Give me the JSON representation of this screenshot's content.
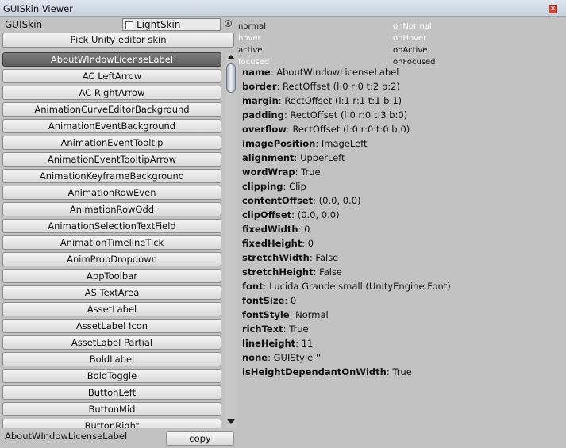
{
  "window": {
    "title": "GUISkin Viewer"
  },
  "skin_field": {
    "label": "GUISkin",
    "value": "LightSkin"
  },
  "pick_button": "Pick Unity editor skin",
  "states": {
    "normal": "normal",
    "onNormal": "onNormal",
    "hover": "hover",
    "onHover": "onHover",
    "active": "active",
    "onActive": "onActive",
    "focused": "focused",
    "onFocused": "onFocused"
  },
  "state_colors": {
    "dark": "#111111",
    "light": "#ffffff"
  },
  "styles": [
    "AboutWIndowLicenseLabel",
    "AC LeftArrow",
    "AC RightArrow",
    "AnimationCurveEditorBackground",
    "AnimationEventBackground",
    "AnimationEventTooltip",
    "AnimationEventTooltipArrow",
    "AnimationKeyframeBackground",
    "AnimationRowEven",
    "AnimationRowOdd",
    "AnimationSelectionTextField",
    "AnimationTimelineTick",
    "AnimPropDropdown",
    "AppToolbar",
    "AS TextArea",
    "AssetLabel",
    "AssetLabel Icon",
    "AssetLabel Partial",
    "BoldLabel",
    "BoldToggle",
    "ButtonLeft",
    "ButtonMid",
    "ButtonRight"
  ],
  "selected_index": 0,
  "properties": [
    {
      "key": "name",
      "value": "AboutWIndowLicenseLabel"
    },
    {
      "key": "border",
      "value": "RectOffset (l:0 r:0 t:2 b:2)"
    },
    {
      "key": "margin",
      "value": "RectOffset (l:1 r:1 t:1 b:1)"
    },
    {
      "key": "padding",
      "value": "RectOffset (l:0 r:0 t:3 b:0)"
    },
    {
      "key": "overflow",
      "value": "RectOffset (l:0 r:0 t:0 b:0)"
    },
    {
      "key": "imagePosition",
      "value": "ImageLeft"
    },
    {
      "key": "alignment",
      "value": "UpperLeft"
    },
    {
      "key": "wordWrap",
      "value": "True"
    },
    {
      "key": "clipping",
      "value": "Clip"
    },
    {
      "key": "contentOffset",
      "value": "(0.0, 0.0)"
    },
    {
      "key": "clipOffset",
      "value": "(0.0, 0.0)"
    },
    {
      "key": "fixedWidth",
      "value": "0"
    },
    {
      "key": "fixedHeight",
      "value": "0"
    },
    {
      "key": "stretchWidth",
      "value": "False"
    },
    {
      "key": "stretchHeight",
      "value": "False"
    },
    {
      "key": "font",
      "value": "Lucida Grande small (UnityEngine.Font)"
    },
    {
      "key": "fontSize",
      "value": "0"
    },
    {
      "key": "fontStyle",
      "value": "Normal"
    },
    {
      "key": "richText",
      "value": "True"
    },
    {
      "key": "lineHeight",
      "value": "11"
    },
    {
      "key": "none",
      "value": "GUIStyle ''"
    },
    {
      "key": "isHeightDependantOnWidth",
      "value": "True"
    }
  ],
  "status": {
    "selected_label": "AboutWIndowLicenseLabel",
    "copy_button": "copy"
  }
}
